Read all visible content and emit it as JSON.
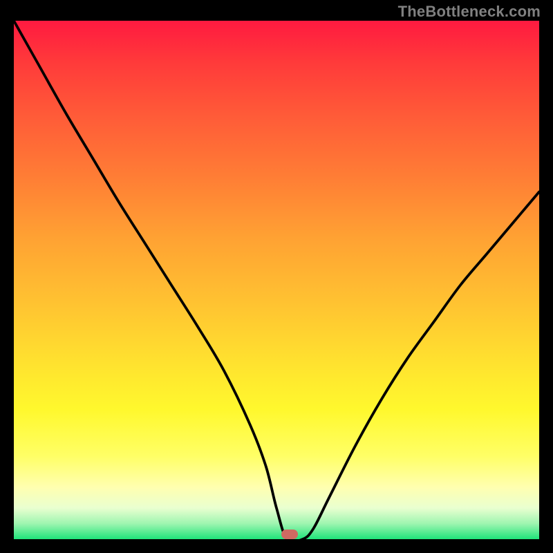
{
  "watermark": "TheBottleneck.com",
  "marker": {
    "x_pct": 52.5,
    "y_pct": 99.0,
    "color": "#cf6a62"
  },
  "gradient_colors": {
    "top": "#ff1a40",
    "mid": "#ffe22f",
    "bottom": "#1fe47a"
  },
  "chart_data": {
    "type": "line",
    "title": "",
    "xlabel": "",
    "ylabel": "",
    "xlim": [
      0,
      100
    ],
    "ylim": [
      0,
      100
    ],
    "series": [
      {
        "name": "bottleneck-curve",
        "x": [
          0,
          5,
          10,
          15,
          20,
          25,
          30,
          35,
          40,
          45,
          48,
          50,
          52,
          55,
          57,
          60,
          65,
          70,
          75,
          80,
          85,
          90,
          95,
          100
        ],
        "y": [
          100,
          91,
          82,
          73.5,
          65,
          57,
          49,
          41,
          32.5,
          22,
          14,
          6,
          0,
          0,
          2,
          8,
          18,
          27,
          35,
          42,
          49,
          55,
          61,
          67
        ]
      }
    ],
    "annotations": [
      {
        "type": "marker",
        "x": 52.5,
        "y": 0.8
      }
    ]
  }
}
